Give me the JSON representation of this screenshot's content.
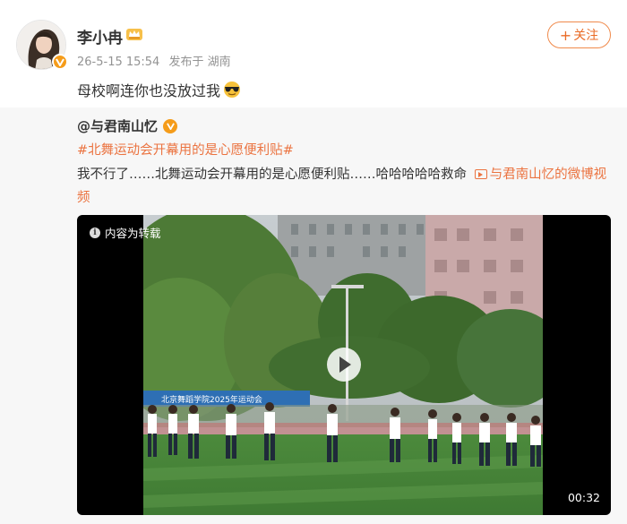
{
  "user": {
    "name": "李小冉",
    "time": "26-5-15 15:54",
    "location": "发布于 湖南",
    "text": "母校啊连你也没放过我",
    "avatar_icon": "avatar-photo",
    "crown_icon": "crown-icon",
    "verified_icon": "verified-badge-icon"
  },
  "follow": {
    "label": "关注"
  },
  "repost": {
    "author": "@与君南山忆",
    "topic": "#北舞运动会开幕用的是心愿便利贴#",
    "text": "我不行了……北舞运动会开幕用的是心愿便利贴……哈哈哈哈哈救命",
    "link_text": "与君南山忆的微博视频"
  },
  "video": {
    "badge": "内容为转载",
    "duration": "00:32",
    "banner_text": "北京舞蹈学院2025年运动会"
  },
  "colors": {
    "accent": "#eb7340",
    "badge": "#f59c1a",
    "repost_bg": "#f7f7f7"
  }
}
